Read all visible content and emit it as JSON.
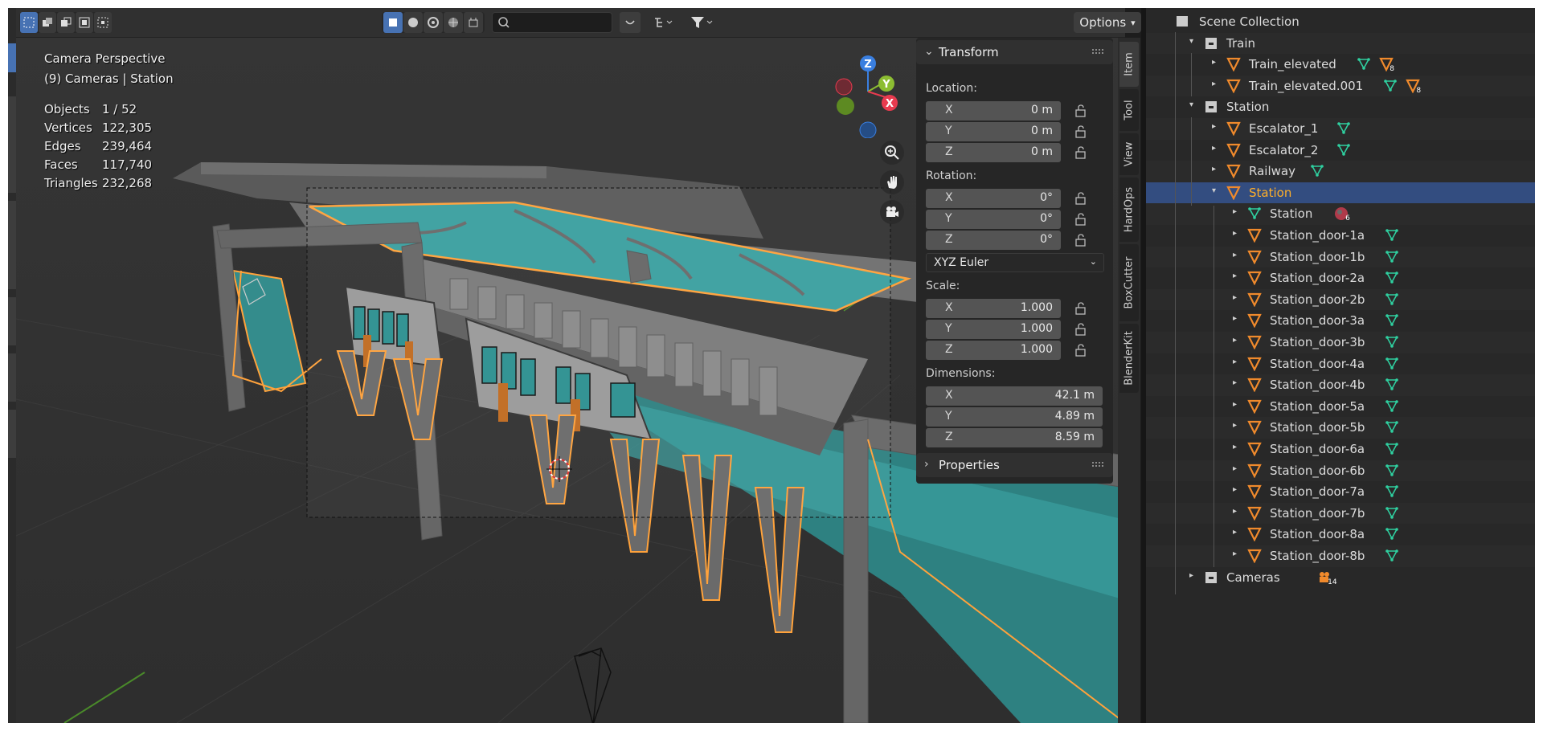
{
  "header": {
    "search_placeholder": "",
    "options_label": "Options",
    "select_mode_icons": [
      "select-box-icon",
      "extend-icon",
      "subtract-icon",
      "difference-icon",
      "intersect-icon"
    ],
    "shading_icons": [
      "wireframe-icon",
      "solid-icon",
      "material-icon",
      "rendered-icon"
    ]
  },
  "viewport": {
    "view_name": "Camera Perspective",
    "context": "(9) Cameras | Station",
    "stats": [
      {
        "label": "Objects",
        "value": "1 / 52"
      },
      {
        "label": "Vertices",
        "value": "122,305"
      },
      {
        "label": "Edges",
        "value": "239,464"
      },
      {
        "label": "Faces",
        "value": "117,740"
      },
      {
        "label": "Triangles",
        "value": "232,268"
      }
    ],
    "gizmo_axes": {
      "z": "Z",
      "y": "Y",
      "x": "X"
    },
    "colors": {
      "x_axis": "#e83b4f",
      "y_axis": "#8cbd32",
      "z_axis": "#3a7fe0",
      "outline": "#ffa23b",
      "glass": "#3aa6a6"
    }
  },
  "transform_panel": {
    "title": "Transform",
    "location_label": "Location:",
    "location": [
      {
        "axis": "X",
        "value": "0 m"
      },
      {
        "axis": "Y",
        "value": "0 m"
      },
      {
        "axis": "Z",
        "value": "0 m"
      }
    ],
    "rotation_label": "Rotation:",
    "rotation": [
      {
        "axis": "X",
        "value": "0°"
      },
      {
        "axis": "Y",
        "value": "0°"
      },
      {
        "axis": "Z",
        "value": "0°"
      }
    ],
    "rotation_mode": "XYZ Euler",
    "scale_label": "Scale:",
    "scale": [
      {
        "axis": "X",
        "value": "1.000"
      },
      {
        "axis": "Y",
        "value": "1.000"
      },
      {
        "axis": "Z",
        "value": "1.000"
      }
    ],
    "dimensions_label": "Dimensions:",
    "dimensions": [
      {
        "axis": "X",
        "value": "42.1 m"
      },
      {
        "axis": "Y",
        "value": "4.89 m"
      },
      {
        "axis": "Z",
        "value": "8.59 m"
      }
    ]
  },
  "properties_panel": {
    "title": "Properties"
  },
  "sidebar_tabs": [
    "Item",
    "Tool",
    "View",
    "HardOps",
    "BoxCutter",
    "BlenderKit"
  ],
  "outliner": {
    "root": "Scene Collection",
    "rows": [
      {
        "label": "Train",
        "type": "collection"
      },
      {
        "label": "Train_elevated",
        "type": "object",
        "badge": "8"
      },
      {
        "label": "Train_elevated.001",
        "type": "object",
        "badge": "8"
      },
      {
        "label": "Station",
        "type": "collection"
      },
      {
        "label": "Escalator_1",
        "type": "object"
      },
      {
        "label": "Escalator_2",
        "type": "object"
      },
      {
        "label": "Railway",
        "type": "object"
      },
      {
        "label": "Station",
        "type": "object",
        "selected": true
      },
      {
        "label": "Station",
        "type": "mesh",
        "badge": "6"
      },
      {
        "label": "Station_door-1a",
        "type": "object"
      },
      {
        "label": "Station_door-1b",
        "type": "object"
      },
      {
        "label": "Station_door-2a",
        "type": "object"
      },
      {
        "label": "Station_door-2b",
        "type": "object"
      },
      {
        "label": "Station_door-3a",
        "type": "object"
      },
      {
        "label": "Station_door-3b",
        "type": "object"
      },
      {
        "label": "Station_door-4a",
        "type": "object"
      },
      {
        "label": "Station_door-4b",
        "type": "object"
      },
      {
        "label": "Station_door-5a",
        "type": "object"
      },
      {
        "label": "Station_door-5b",
        "type": "object"
      },
      {
        "label": "Station_door-6a",
        "type": "object"
      },
      {
        "label": "Station_door-6b",
        "type": "object"
      },
      {
        "label": "Station_door-7a",
        "type": "object"
      },
      {
        "label": "Station_door-7b",
        "type": "object"
      },
      {
        "label": "Station_door-8a",
        "type": "object"
      },
      {
        "label": "Station_door-8b",
        "type": "object"
      },
      {
        "label": "Cameras",
        "type": "collection",
        "badge": "14"
      }
    ]
  }
}
